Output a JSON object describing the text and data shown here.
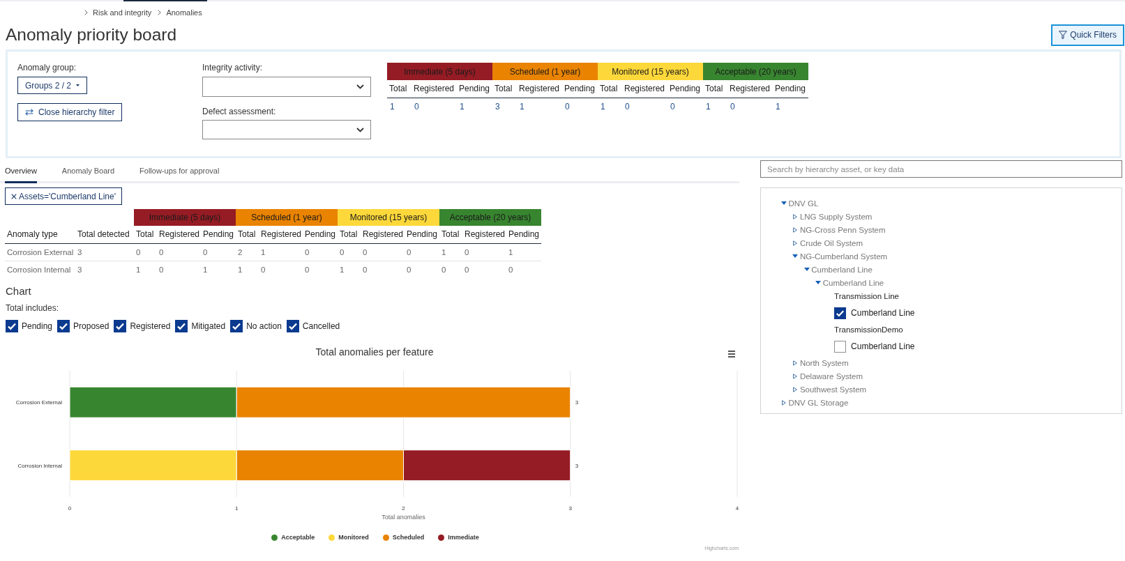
{
  "breadcrumb": [
    {
      "label": "Risk and integrity"
    },
    {
      "label": "Anomalies"
    }
  ],
  "header": {
    "title": "Anomaly priority board",
    "quick_filters": "Quick Filters"
  },
  "filters": {
    "anomaly_group": {
      "label": "Anomaly group:",
      "value": "Groups 2 / 2"
    },
    "hierarchy_button": "Close hierarchy filter",
    "integrity_activity": {
      "label": "Integrity activity:"
    },
    "defect_assessment": {
      "label": "Defect assessment:"
    },
    "summary": {
      "categories": [
        {
          "label": "Immediate (5 days)",
          "color": "#951c24",
          "columns": [
            "Total",
            "Registered",
            "Pending"
          ],
          "values": [
            "1",
            "0",
            "1"
          ]
        },
        {
          "label": "Scheduled (1 year)",
          "color": "#e98300",
          "columns": [
            "Total",
            "Registered",
            "Pending"
          ],
          "values": [
            "3",
            "1",
            "0"
          ]
        },
        {
          "label": "Monitored (15 years)",
          "color": "#fdd83a",
          "columns": [
            "Total",
            "Registered",
            "Pending"
          ],
          "values": [
            "1",
            "0",
            "0"
          ]
        },
        {
          "label": "Acceptable (20 years)",
          "color": "#388530",
          "columns": [
            "Total",
            "Registered",
            "Pending"
          ],
          "values": [
            "1",
            "0",
            "1"
          ]
        }
      ]
    }
  },
  "tabs": [
    {
      "label": "Overview",
      "selected": true
    },
    {
      "label": "Anomaly Board",
      "selected": false
    },
    {
      "label": "Follow-ups for approval",
      "selected": false
    }
  ],
  "active_filter": {
    "label": "Assets='Cumberland Line'"
  },
  "table": {
    "columns": [
      "Anomaly type",
      "Total detected"
    ],
    "categories": [
      {
        "label": "Immediate (5 days)",
        "color": "#951c24",
        "columns": [
          "Total",
          "Registered",
          "Pending"
        ]
      },
      {
        "label": "Scheduled (1 year)",
        "color": "#e98300",
        "columns": [
          "Total",
          "Registered",
          "Pending"
        ]
      },
      {
        "label": "Monitored (15 years)",
        "color": "#fdd83a",
        "columns": [
          "Total",
          "Registered",
          "Pending"
        ]
      },
      {
        "label": "Acceptable (20 years)",
        "color": "#388530",
        "columns": [
          "Total",
          "Registered",
          "Pending"
        ]
      }
    ],
    "rows": [
      {
        "cells": [
          "Corrosion External",
          "3",
          "0",
          "0",
          "0",
          "2",
          "1",
          "0",
          "0",
          "0",
          "0",
          "1",
          "0",
          "1"
        ]
      },
      {
        "cells": [
          "Corrosion Internal",
          "3",
          "1",
          "0",
          "1",
          "1",
          "0",
          "0",
          "1",
          "0",
          "0",
          "0",
          "0",
          "0"
        ]
      }
    ]
  },
  "chart_section": {
    "heading": "Chart",
    "includes_label": "Total includes:",
    "includes": [
      {
        "label": "Pending",
        "checked": true
      },
      {
        "label": "Proposed",
        "checked": true
      },
      {
        "label": "Registered",
        "checked": true
      },
      {
        "label": "Mitigated",
        "checked": true
      },
      {
        "label": "No action",
        "checked": true
      },
      {
        "label": "Cancelled",
        "checked": true
      }
    ],
    "chart_data": {
      "type": "bar",
      "orientation": "horizontal",
      "stacked": true,
      "grid": true,
      "legend": "bottom",
      "title": "Total anomalies per feature",
      "xlabel": "Total anomalies",
      "categories": [
        "Corrosion External",
        "Corrosion Internal"
      ],
      "series": [
        {
          "name": "Acceptable",
          "color": "#388530",
          "values": [
            1,
            0
          ]
        },
        {
          "name": "Monitored",
          "color": "#fdd83a",
          "values": [
            0,
            1
          ]
        },
        {
          "name": "Scheduled",
          "color": "#e98300",
          "values": [
            2,
            1
          ]
        },
        {
          "name": "Immediate",
          "color": "#951c24",
          "values": [
            0,
            1
          ]
        }
      ],
      "xlim": [
        0,
        4
      ],
      "xticks": [
        {
          "value": 0,
          "label": "0"
        },
        {
          "value": 1,
          "label": "1"
        },
        {
          "value": 2,
          "label": "2"
        },
        {
          "value": 3,
          "label": "3"
        },
        {
          "value": 4,
          "label": "4"
        }
      ],
      "annotations": [
        {
          "text": "3"
        },
        {
          "text": "3"
        }
      ]
    },
    "credit": "Highcharts.com"
  },
  "hierarchy": {
    "search": {
      "placeholder": "Search by hierarchy asset, or key data"
    },
    "tree": [
      {
        "kind": "node",
        "label": "DNV GL",
        "expanded": true,
        "children": [
          {
            "kind": "node",
            "label": "LNG Supply System",
            "expanded": false
          },
          {
            "kind": "node",
            "label": "NG-Cross Penn System",
            "expanded": false
          },
          {
            "kind": "node",
            "label": "Crude Oil System",
            "expanded": false
          },
          {
            "kind": "node",
            "label": "NG-Cumberland System",
            "expanded": true,
            "children": [
              {
                "kind": "node",
                "label": "Cumberland Line",
                "expanded": true,
                "children": [
                  {
                    "kind": "node",
                    "label": "Cumberland Line",
                    "expanded": true,
                    "children": [
                      {
                        "kind": "group",
                        "label": "Transmission Line",
                        "children": [
                          {
                            "kind": "check",
                            "label": "Cumberland Line",
                            "checked": true
                          }
                        ]
                      },
                      {
                        "kind": "group",
                        "label": "TransmissionDemo",
                        "children": [
                          {
                            "kind": "check",
                            "label": "Cumberland Line",
                            "checked": false
                          }
                        ]
                      }
                    ]
                  }
                ]
              }
            ]
          },
          {
            "kind": "node",
            "label": "North System",
            "expanded": false
          },
          {
            "kind": "node",
            "label": "Delaware System",
            "expanded": false
          },
          {
            "kind": "node",
            "label": "Southwest System",
            "expanded": false
          }
        ]
      },
      {
        "kind": "node",
        "label": "DNV GL Storage",
        "expanded": false
      }
    ]
  }
}
